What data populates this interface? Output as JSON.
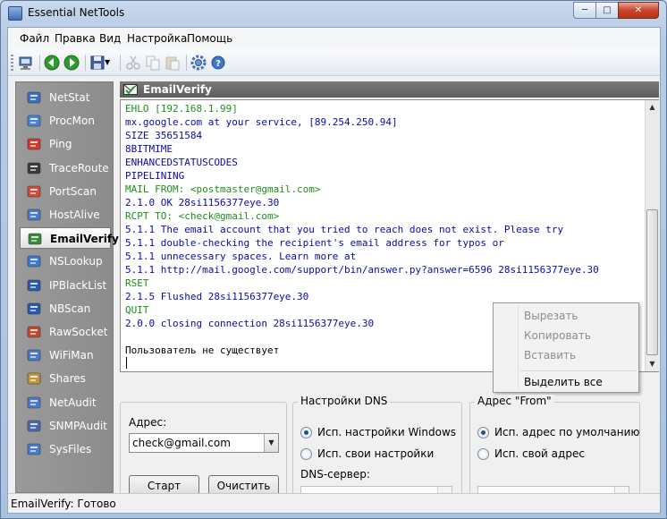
{
  "window": {
    "title": "Essential NetTools",
    "minimize": "─",
    "maximize": "□",
    "close": "✕"
  },
  "menu": [
    "Файл",
    "Правка",
    "Вид",
    "Настройка",
    "Помощь"
  ],
  "toolbar": {
    "icons": [
      "grip-icon",
      "computer-icon",
      "back-arrow-icon",
      "forward-arrow-icon",
      "save-icon",
      "dropdown-arrow-icon",
      "cut-icon",
      "copy-icon",
      "paste-icon",
      "settings-icon",
      "help-icon"
    ]
  },
  "sidebar": {
    "items": [
      {
        "label": "NetStat",
        "icon": "netstat-icon",
        "color": "#3a70c0"
      },
      {
        "label": "ProcMon",
        "icon": "procmon-icon",
        "color": "#4b84d0"
      },
      {
        "label": "Ping",
        "icon": "ping-icon",
        "color": "#d23a2a"
      },
      {
        "label": "TraceRoute",
        "icon": "traceroute-icon",
        "color": "#3a3a3a"
      },
      {
        "label": "PortScan",
        "icon": "portscan-icon",
        "color": "#d24a3a"
      },
      {
        "label": "HostAlive",
        "icon": "hostalive-icon",
        "color": "#4a7ad0"
      },
      {
        "label": "EmailVerify",
        "icon": "email-verify-icon",
        "color": "#3b8a3b",
        "active": true
      },
      {
        "label": "NSLookup",
        "icon": "nslookup-icon",
        "color": "#3a7ad0"
      },
      {
        "label": "IPBlackList",
        "icon": "ipblacklist-icon",
        "color": "#2a5ab0"
      },
      {
        "label": "NBScan",
        "icon": "nbscan-icon",
        "color": "#2a5ab0"
      },
      {
        "label": "RawSocket",
        "icon": "rawsocket-icon",
        "color": "#c04a2a"
      },
      {
        "label": "WiFiMan",
        "icon": "wifiman-icon",
        "color": "#4a7ac0"
      },
      {
        "label": "Shares",
        "icon": "shares-icon",
        "color": "#c09a3a"
      },
      {
        "label": "NetAudit",
        "icon": "netaudit-icon",
        "color": "#4a7ad0"
      },
      {
        "label": "SNMPAudit",
        "icon": "snmpaudit-icon",
        "color": "#4a6ab0"
      },
      {
        "label": "SysFiles",
        "icon": "sysfiles-icon",
        "color": "#4a7ad0"
      }
    ]
  },
  "panel": {
    "title": "EmailVerify",
    "icon": "email-check-icon"
  },
  "log": {
    "lines": [
      {
        "text": "EHLO [192.168.1.99]",
        "kind": "sent"
      },
      {
        "text": "mx.google.com at your service, [89.254.250.94]",
        "kind": "recv"
      },
      {
        "text": "SIZE 35651584",
        "kind": "recv"
      },
      {
        "text": "8BITMIME",
        "kind": "recv"
      },
      {
        "text": "ENHANCEDSTATUSCODES",
        "kind": "recv"
      },
      {
        "text": "PIPELINING",
        "kind": "recv"
      },
      {
        "text": "MAIL FROM: <postmaster@gmail.com>",
        "kind": "sent"
      },
      {
        "text": "2.1.0 OK 28si1156377eye.30",
        "kind": "recv"
      },
      {
        "text": "RCPT TO: <check@gmail.com>",
        "kind": "sent"
      },
      {
        "text": "5.1.1 The email account that you tried to reach does not exist. Please try",
        "kind": "recv"
      },
      {
        "text": "5.1.1 double-checking the recipient's email address for typos or",
        "kind": "recv"
      },
      {
        "text": "5.1.1 unnecessary spaces. Learn more at",
        "kind": "recv"
      },
      {
        "text": "5.1.1 http://mail.google.com/support/bin/answer.py?answer=6596 28si1156377eye.30",
        "kind": "recv"
      },
      {
        "text": "RSET",
        "kind": "sent"
      },
      {
        "text": "2.1.5 Flushed 28si1156377eye.30",
        "kind": "recv"
      },
      {
        "text": "QUIT",
        "kind": "sent"
      },
      {
        "text": "2.0.0 closing connection 28si1156377eye.30",
        "kind": "recv"
      },
      {
        "text": "",
        "kind": "result"
      },
      {
        "text": "Пользователь не существует",
        "kind": "result"
      }
    ]
  },
  "context_menu": {
    "items": [
      {
        "label": "Вырезать",
        "enabled": false
      },
      {
        "label": "Копировать",
        "enabled": false
      },
      {
        "label": "Вставить",
        "enabled": false
      },
      {
        "label": "Выделить все",
        "enabled": true
      }
    ]
  },
  "form": {
    "address_label": "Адрес:",
    "address_value": "check@gmail.com",
    "start_button": "Старт",
    "clear_button": "Очистить",
    "dns_group": {
      "title": "Настройки DNS",
      "options": [
        {
          "label": "Исп. настройки Windows",
          "checked": true
        },
        {
          "label": "Исп. свои настройки",
          "checked": false
        }
      ],
      "server_label": "DNS-сервер:",
      "server_value": ""
    },
    "from_group": {
      "title": "Адрес \"From\"",
      "options": [
        {
          "label": "Исп. адрес по умолчанию",
          "checked": true
        },
        {
          "label": "Исп. свой адрес",
          "checked": false
        }
      ],
      "address_value": ""
    }
  },
  "status": {
    "text": "EmailVerify: Готово"
  },
  "colors": {
    "sent": "#1b8f1b",
    "received": "#0a0aa8",
    "sidebar_bg": "#8f8f8f",
    "panel_header": "#6a6a6a"
  }
}
